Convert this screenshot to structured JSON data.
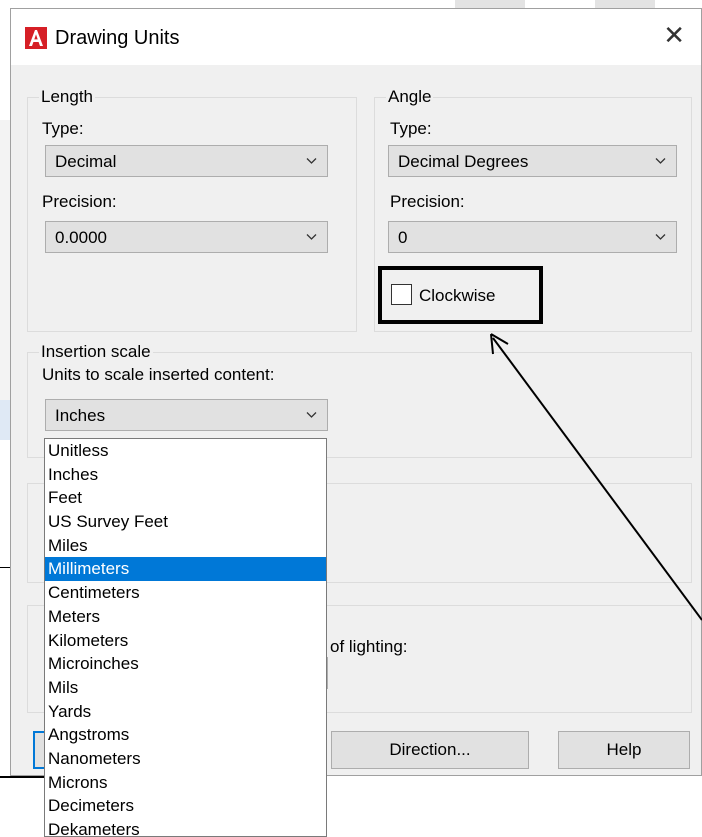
{
  "dialog": {
    "title": "Drawing Units",
    "close_icon": "close-icon"
  },
  "length": {
    "legend": "Length",
    "type_label": "Type:",
    "type_value": "Decimal",
    "precision_label": "Precision:",
    "precision_value": "0.0000"
  },
  "angle": {
    "legend": "Angle",
    "type_label": "Type:",
    "type_value": "Decimal Degrees",
    "precision_label": "Precision:",
    "precision_value": "0",
    "clockwise_label": "Clockwise",
    "clockwise_checked": false
  },
  "insertion": {
    "legend": "Insertion scale",
    "units_label": "Units to scale inserted content:",
    "units_value": "Inches"
  },
  "lighting": {
    "partial_label": "of lighting:"
  },
  "buttons": {
    "direction": "Direction...",
    "help": "Help"
  },
  "units_list": {
    "items": [
      "Unitless",
      "Inches",
      "Feet",
      "US Survey Feet",
      "Miles",
      "Millimeters",
      "Centimeters",
      "Meters",
      "Kilometers",
      "Microinches",
      "Mils",
      "Yards",
      "Angstroms",
      "Nanometers",
      "Microns",
      "Decimeters",
      "Dekameters"
    ],
    "selected": "Millimeters"
  },
  "colors": {
    "selection": "#0078d7",
    "dialog_bg": "#f0f0f0",
    "autocad_red": "#d61f26"
  }
}
